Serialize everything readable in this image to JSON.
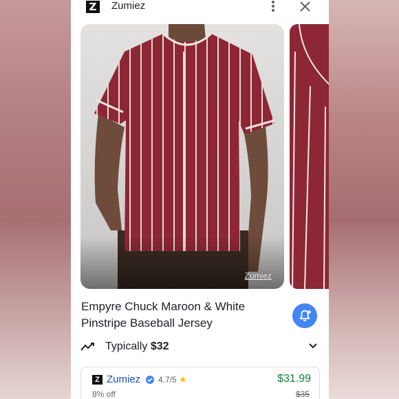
{
  "header": {
    "logo_letter": "Z",
    "brand": "Zumiez"
  },
  "gallery": {
    "watermark": "Zumiez"
  },
  "product": {
    "title": "Empyre Chuck Maroon & White Pinstripe Baseball Jersey",
    "typically_label": "Typically",
    "typical_price": "$32"
  },
  "offer": {
    "logo_letter": "Z",
    "store": "Zumiez",
    "rating": "4.7/5",
    "price": "$31.99",
    "discount": "8% off",
    "old_price": "$35"
  },
  "colors": {
    "accent": "#4285f4",
    "price_green": "#188038",
    "store_link": "#1a4fbf",
    "jersey": "#8b2632"
  },
  "icons": [
    "more-vert-icon",
    "close-icon",
    "price-alert-icon",
    "trend-icon",
    "chevron-down-icon",
    "verified-badge-icon",
    "star-icon"
  ]
}
